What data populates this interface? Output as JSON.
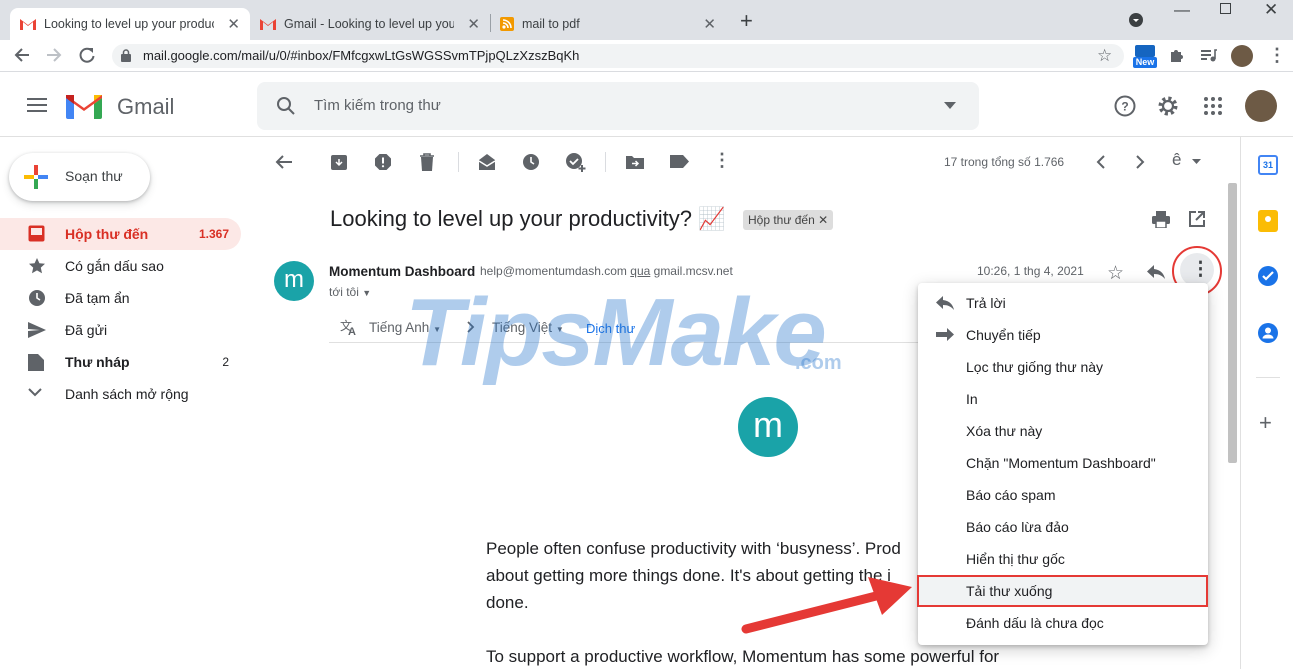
{
  "browser": {
    "tabs": [
      {
        "title": "Looking to level up your product"
      },
      {
        "title": "Gmail - Looking to level up your p"
      },
      {
        "title": "mail to pdf"
      }
    ],
    "new_tab": "+",
    "url": "mail.google.com/mail/u/0/#inbox/FMfcgxwLtGsWGSSvmTPjpQLzXzszBqKh",
    "new_badge": "New"
  },
  "header": {
    "app_name": "Gmail",
    "search_placeholder": "Tìm kiếm trong thư"
  },
  "sidebar": {
    "compose": "Soạn thư",
    "items": [
      {
        "label": "Hộp thư đến",
        "count": "1.367"
      },
      {
        "label": "Có gắn dấu sao",
        "count": ""
      },
      {
        "label": "Đã tạm ẩn",
        "count": ""
      },
      {
        "label": "Đã gửi",
        "count": ""
      },
      {
        "label": "Thư nháp",
        "count": "2"
      },
      {
        "label": "Danh sách mở rộng",
        "count": ""
      }
    ]
  },
  "toolbar": {
    "page_info": "17 trong tổng số 1.766",
    "lang_glyph": "ê"
  },
  "message": {
    "subject": "Looking to level up your productivity? 📈",
    "label": "Hộp thư đến",
    "sender_name": "Momentum Dashboard",
    "sender_email": "help@momentumdash.com",
    "via_word": "qua",
    "via_domain": "gmail.mcsv.net",
    "to": "tới tôi",
    "date": "10:26, 1 thg 4, 2021",
    "avatar_letter": "m",
    "translate": {
      "from": "Tiếng Anh",
      "to": "Tiếng Việt",
      "action": "Dịch thư"
    },
    "body": [
      "People often confuse productivity with ‘busyness’. Prod",
      "about getting more things done. It's about getting the i",
      "done.",
      "To support a productive workflow, Momentum has some powerful for"
    ]
  },
  "menu": {
    "items": [
      {
        "label": "Trả lời"
      },
      {
        "label": "Chuyển tiếp"
      },
      {
        "label": "Lọc thư giống thư này"
      },
      {
        "label": "In"
      },
      {
        "label": "Xóa thư này"
      },
      {
        "label": "Chặn \"Momentum Dashboard\""
      },
      {
        "label": "Báo cáo spam"
      },
      {
        "label": "Báo cáo lừa đảo"
      },
      {
        "label": "Hiển thị thư gốc"
      },
      {
        "label": "Tải thư xuống"
      },
      {
        "label": "Đánh dấu là chưa đọc"
      }
    ]
  },
  "watermark": {
    "main": "TipsMake",
    "suffix": ".com"
  },
  "colors": {
    "accent_red": "#d93025",
    "highlight": "#e53935",
    "teal": "#1aa3a8"
  }
}
